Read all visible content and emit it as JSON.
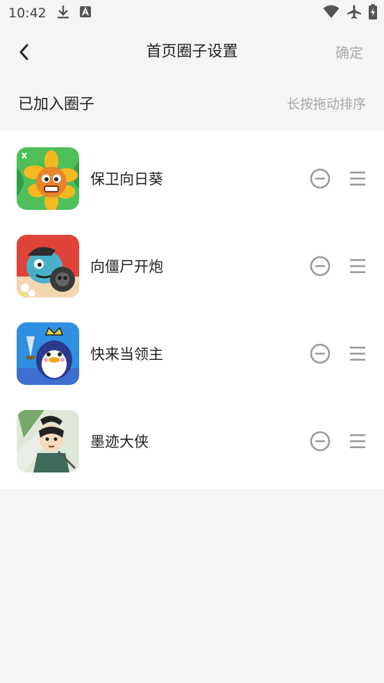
{
  "status_bar": {
    "time": "10:42",
    "left_icons": [
      "download-icon",
      "a-letter-icon"
    ],
    "right_icons": [
      "wifi-icon",
      "airplane-mode-icon",
      "battery-charging-icon"
    ]
  },
  "nav": {
    "back_icon": "chevron-left-icon",
    "title": "首页圈子设置",
    "confirm_label": "确定"
  },
  "section": {
    "title": "已加入圈子",
    "hint": "长按拖动排序"
  },
  "circles": [
    {
      "name": "保卫向日葵",
      "icon": "sunflower-game-icon"
    },
    {
      "name": "向僵尸开炮",
      "icon": "zombie-cannon-game-icon"
    },
    {
      "name": "快来当领主",
      "icon": "penguin-lord-game-icon"
    },
    {
      "name": "墨迹大侠",
      "icon": "ink-hero-game-icon"
    }
  ],
  "colors": {
    "background": "#f4f5f5",
    "list_background": "#ffffff",
    "muted_text": "#a6a6a6",
    "icon_gray": "#9a9a9a"
  }
}
